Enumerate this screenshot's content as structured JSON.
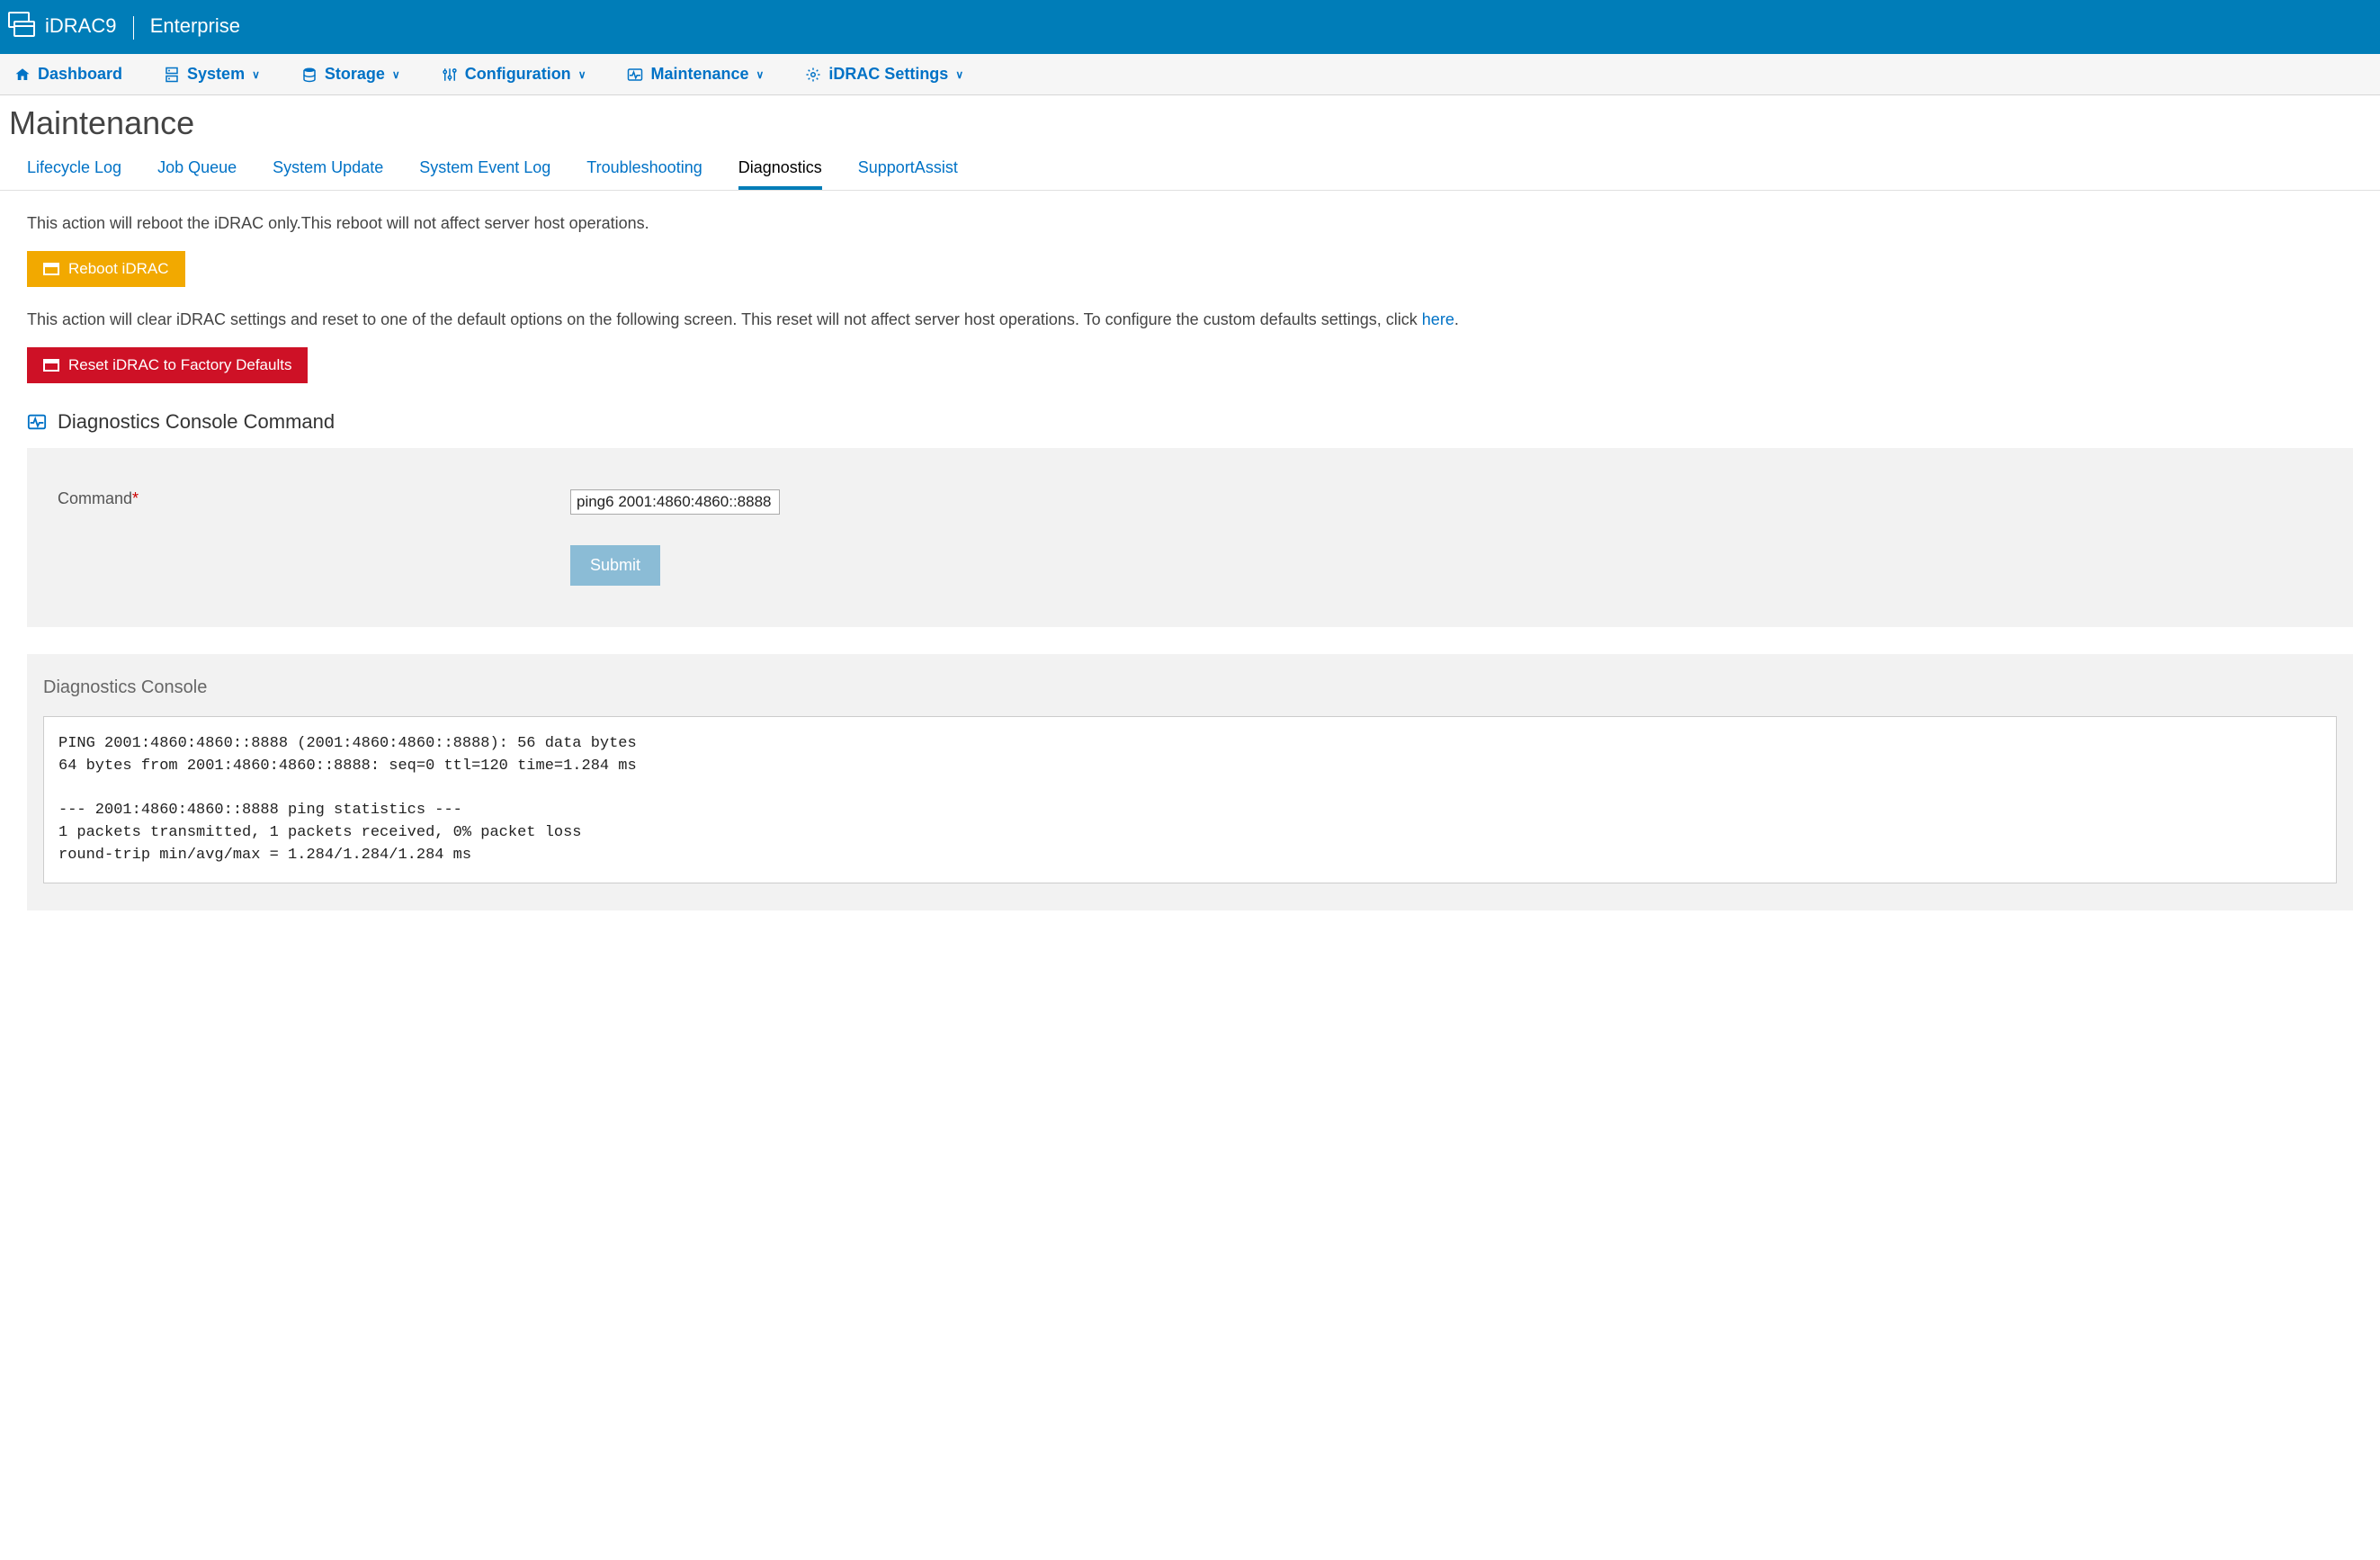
{
  "brand": {
    "product": "iDRAC9",
    "edition": "Enterprise"
  },
  "nav": {
    "dashboard": "Dashboard",
    "system": "System",
    "storage": "Storage",
    "configuration": "Configuration",
    "maintenance": "Maintenance",
    "idrac_settings": "iDRAC Settings"
  },
  "page_title": "Maintenance",
  "tabs": {
    "lifecycle": "Lifecycle Log",
    "jobqueue": "Job Queue",
    "sysupdate": "System Update",
    "sel": "System Event Log",
    "troubleshoot": "Troubleshooting",
    "diagnostics": "Diagnostics",
    "supportassist": "SupportAssist"
  },
  "reboot": {
    "info": "This action will reboot the iDRAC only.This reboot will not affect server host operations.",
    "button": "Reboot iDRAC"
  },
  "reset": {
    "info_prefix": "This action will clear iDRAC settings and reset to one of the default options on the following screen. This reset will not affect server host operations. To configure the custom defaults settings, click ",
    "info_link": "here",
    "info_suffix": ".",
    "button": "Reset iDRAC to Factory Defaults"
  },
  "diag": {
    "section_title": "Diagnostics Console Command",
    "command_label": "Command",
    "command_value": "ping6 2001:4860:4860::8888",
    "submit": "Submit",
    "output_title": "Diagnostics Console",
    "output_text": "PING 2001:4860:4860::8888 (2001:4860:4860::8888): 56 data bytes\n64 bytes from 2001:4860:4860::8888: seq=0 ttl=120 time=1.284 ms\n\n--- 2001:4860:4860::8888 ping statistics ---\n1 packets transmitted, 1 packets received, 0% packet loss\nround-trip min/avg/max = 1.284/1.284/1.284 ms"
  }
}
